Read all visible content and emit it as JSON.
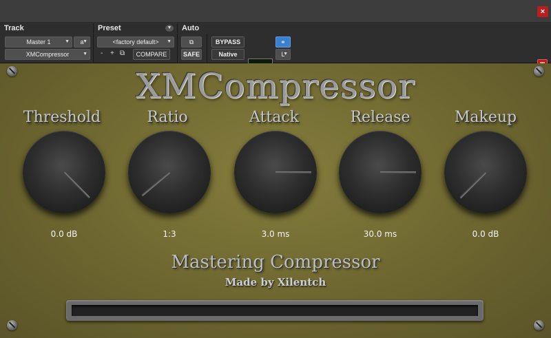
{
  "window": {
    "close_glyph": "×"
  },
  "header": {
    "track": {
      "title": "Track",
      "track_name": "Master 1",
      "track_suffix": "a",
      "insert_name": "XMCompressor"
    },
    "preset": {
      "title": "Preset",
      "preset_name": "<factory default>",
      "minus_label": "-",
      "plus_label": "+",
      "compare_label": "COMPARE"
    },
    "auto": {
      "title": "Auto",
      "safe_label": "SAFE"
    },
    "bypass_label": "BYPASS",
    "native_label": "Native",
    "link_icon": "link-icon",
    "side_select": "L"
  },
  "plugin": {
    "title": "XMCompressor",
    "subtitle": "Mastering Compressor",
    "credit": "Made by Xilentch",
    "meter_level": 0,
    "knobs": [
      {
        "id": "threshold",
        "label": "Threshold",
        "value": "0.0 dB",
        "angle": 45
      },
      {
        "id": "ratio",
        "label": "Ratio",
        "value": "1:3",
        "angle": 140
      },
      {
        "id": "attack",
        "label": "Attack",
        "value": "3.0 ms",
        "angle": 0
      },
      {
        "id": "release",
        "label": "Release",
        "value": "30.0 ms",
        "angle": 0
      },
      {
        "id": "makeup",
        "label": "Makeup",
        "value": "0.0 dB",
        "angle": 135
      }
    ]
  },
  "colors": {
    "panel": "#6d6630",
    "close": "#b81e1e",
    "meter_led": "#2fb82f",
    "link_button": "#3a7fd0"
  }
}
